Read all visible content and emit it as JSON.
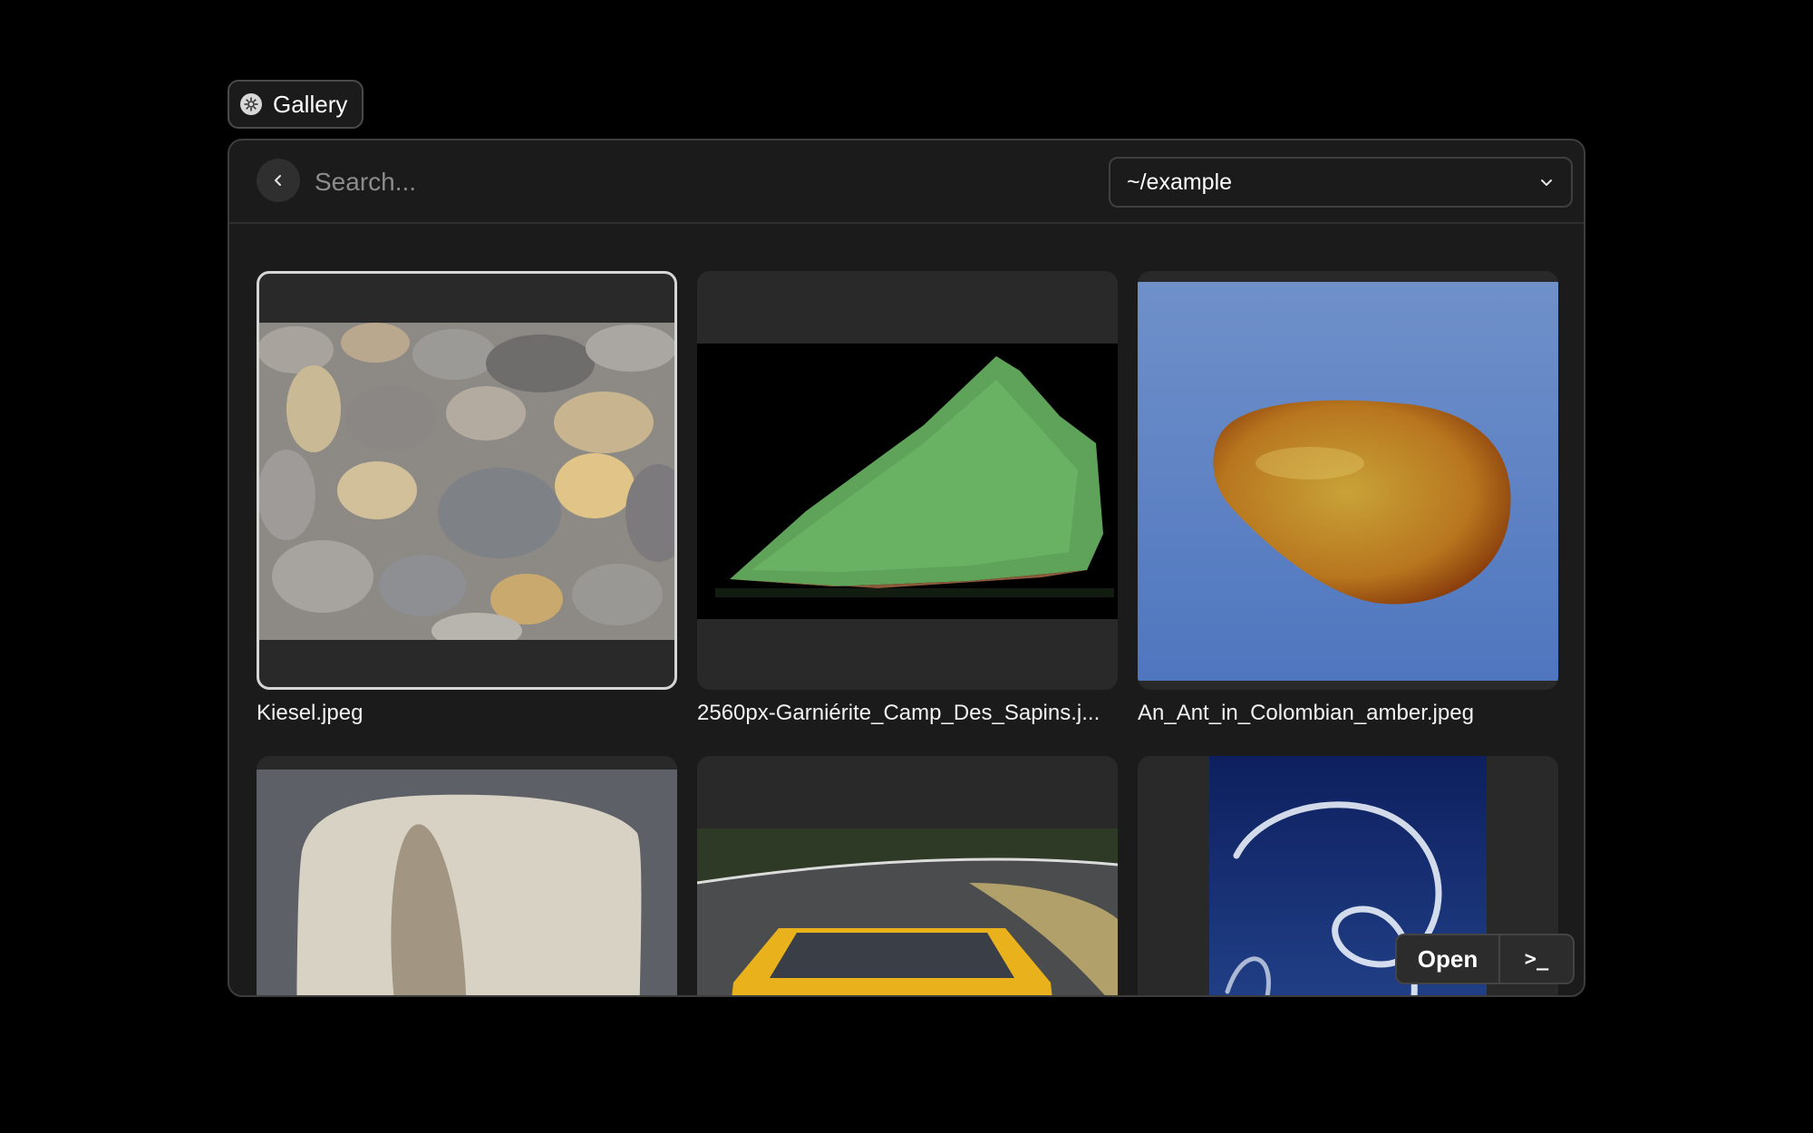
{
  "app_tab": {
    "label": "Gallery",
    "icon": "gallery-logo-icon"
  },
  "toolbar": {
    "back_icon": "chevron-left-icon",
    "search_placeholder": "Search...",
    "search_value": "",
    "directory": "~/example",
    "directory_icon": "chevron-down-icon"
  },
  "items": [
    {
      "caption": "Kiesel.jpeg",
      "selected": true
    },
    {
      "caption": "2560px-Garniérite_Camp_Des_Sapins.j...",
      "selected": false
    },
    {
      "caption": "An_Ant_in_Colombian_amber.jpeg",
      "selected": false
    },
    {
      "caption": "",
      "selected": false
    },
    {
      "caption": "",
      "selected": false
    },
    {
      "caption": "",
      "selected": false
    }
  ],
  "actions": {
    "open_label": "Open",
    "terminal_label": ">_"
  },
  "colors": {
    "background": "#000000",
    "panel": "#1b1b1b",
    "tile": "#292929",
    "selected_border": "#d6d6d6"
  }
}
